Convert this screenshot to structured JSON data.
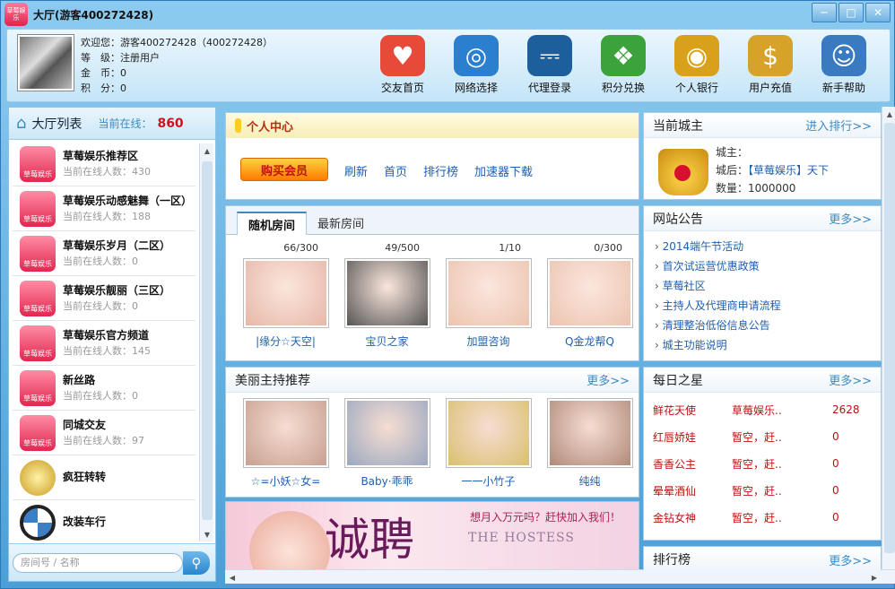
{
  "window": {
    "title": "大厅(游客400272428)",
    "logo_text": "草莓娱乐"
  },
  "user": {
    "welcome": "欢迎您：游客400272428（400272428）",
    "level": "等　级：注册用户",
    "coins": "金　币：0",
    "points": "积　分：0"
  },
  "toolbar": [
    {
      "label": "交友首页",
      "icon": "house-heart-icon",
      "color": "#e84a3a"
    },
    {
      "label": "网络选择",
      "icon": "globe-icon",
      "color": "#2b7fcf"
    },
    {
      "label": "代理登录",
      "icon": "monitor-icon",
      "color": "#1d5f9c"
    },
    {
      "label": "积分兑换",
      "icon": "gift-icon",
      "color": "#3ca33c"
    },
    {
      "label": "个人银行",
      "icon": "coins-icon",
      "color": "#d9a11a"
    },
    {
      "label": "用户充值",
      "icon": "money-bag-icon",
      "color": "#d6a22a"
    },
    {
      "label": "新手帮助",
      "icon": "people-icon",
      "color": "#3a7ac0"
    }
  ],
  "hall": {
    "title": "大厅列表",
    "online_label": "当前在线：",
    "online_count": "860",
    "items": [
      {
        "name": "草莓娱乐推荐区",
        "sub": "当前在线人数：430",
        "type": "logo",
        "logo_text": "草莓娱乐"
      },
      {
        "name": "草莓娱乐动感魅舞（一区）",
        "sub": "当前在线人数：188",
        "type": "logo",
        "logo_text": "草莓娱乐"
      },
      {
        "name": "草莓娱乐岁月（二区）",
        "sub": "当前在线人数：0",
        "type": "logo",
        "logo_text": "草莓娱乐"
      },
      {
        "name": "草莓娱乐靓丽（三区）",
        "sub": "当前在线人数：0",
        "type": "logo",
        "logo_text": "草莓娱乐"
      },
      {
        "name": "草莓娱乐官方频道",
        "sub": "当前在线人数：145",
        "type": "logo",
        "logo_text": "草莓娱乐"
      },
      {
        "name": "新丝路",
        "sub": "当前在线人数：0",
        "type": "logo",
        "logo_text": "草莓娱乐"
      },
      {
        "name": "同城交友",
        "sub": "当前在线人数：97",
        "type": "logo",
        "logo_text": "草莓娱乐"
      },
      {
        "name": "疯狂转转",
        "sub": "",
        "type": "coin",
        "logo_text": ""
      },
      {
        "name": "改装车行",
        "sub": "",
        "type": "bmw",
        "logo_text": ""
      }
    ],
    "search_placeholder": "房间号 / 名称"
  },
  "personal": {
    "title": "个人中心",
    "buy_button": "购买会员",
    "links": [
      "刷新",
      "首页",
      "排行榜",
      "加速器下载"
    ]
  },
  "rooms": {
    "tabs": [
      "随机房间",
      "最新房间"
    ],
    "active_tab": 0,
    "items": [
      {
        "count": "66/300",
        "name": "|缘分☆天空|",
        "tone": "#e7b7a8"
      },
      {
        "count": "49/500",
        "name": "宝贝之家",
        "tone": "#555555"
      },
      {
        "count": "1/10",
        "name": "加盟咨询",
        "tone": "#ecc4b0"
      },
      {
        "count": "0/300",
        "name": "Q金龙帮Q",
        "tone": "#ecc4b0"
      }
    ]
  },
  "hosts": {
    "title": "美丽主持推荐",
    "more": "更多>>",
    "items": [
      {
        "name": "☆=小妖☆女=",
        "tone": "#c7a090"
      },
      {
        "name": "Baby·乖乖",
        "tone": "#9aa8c0"
      },
      {
        "name": "一一小竹子",
        "tone": "#d9c070"
      },
      {
        "name": "纯纯",
        "tone": "#b08a7a"
      }
    ]
  },
  "banner": {
    "line1": "想月入万元吗？赶快加入我们！",
    "line2": "THE HOSTESS",
    "big": "诚聘"
  },
  "city_lord": {
    "title": "当前城主",
    "more": "进入排行>>",
    "lord": "城主：",
    "queen_label": "城后：",
    "queen_value": "【草莓娱乐】天下",
    "amount": "数量：1000000"
  },
  "notice": {
    "title": "网站公告",
    "more": "更多>>",
    "items": [
      "2014端午节活动",
      "首次试运营优惠政策",
      "草莓社区",
      "主持人及代理商申请流程",
      "清理整治低俗信息公告",
      "城主功能说明"
    ]
  },
  "daily_star": {
    "title": "每日之星",
    "more": "更多>>",
    "rows": [
      {
        "a": "鲜花天使",
        "b": "草莓娱乐..",
        "c": "2628"
      },
      {
        "a": "红唇娇娃",
        "b": "暂空，赶..",
        "c": "0"
      },
      {
        "a": "香香公主",
        "b": "暂空，赶..",
        "c": "0"
      },
      {
        "a": "晕晕酒仙",
        "b": "暂空，赶..",
        "c": "0"
      },
      {
        "a": "金钻女神",
        "b": "暂空，赶..",
        "c": "0"
      }
    ]
  },
  "ranking": {
    "title": "排行榜",
    "more": "更多>>"
  }
}
